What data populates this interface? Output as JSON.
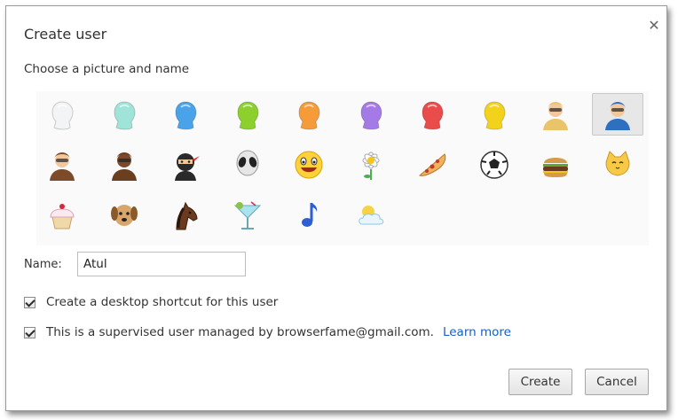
{
  "dialog": {
    "title": "Create user",
    "subtitle": "Choose a picture and name",
    "close_icon": "close-icon",
    "name_label": "Name:",
    "name_value": "Atul",
    "shortcut_label": "Create a desktop shortcut for this user",
    "shortcut_checked": true,
    "supervised_label": "This is a supervised user managed by browserfame@gmail.com.",
    "supervised_checked": true,
    "learn_more": "Learn more",
    "create_label": "Create",
    "cancel_label": "Cancel"
  },
  "avatars": [
    {
      "name": "avatar-head-white",
      "kind": "head",
      "color": "#f2f4f5",
      "selected": false
    },
    {
      "name": "avatar-head-teal",
      "kind": "head",
      "color": "#9fe3d9",
      "selected": false
    },
    {
      "name": "avatar-head-blue",
      "kind": "head",
      "color": "#4aa3e8",
      "selected": false
    },
    {
      "name": "avatar-head-green",
      "kind": "head",
      "color": "#8dcf2d",
      "selected": false
    },
    {
      "name": "avatar-head-orange",
      "kind": "head",
      "color": "#f59b3a",
      "selected": false
    },
    {
      "name": "avatar-head-purple",
      "kind": "head",
      "color": "#a47ae6",
      "selected": false
    },
    {
      "name": "avatar-head-red",
      "kind": "head",
      "color": "#ea4b4b",
      "selected": false
    },
    {
      "name": "avatar-head-yellow",
      "kind": "head",
      "color": "#f3d21c",
      "selected": false
    },
    {
      "name": "avatar-businesswoman",
      "kind": "person",
      "color": "#e9c46a",
      "selected": false
    },
    {
      "name": "avatar-superhero",
      "kind": "person",
      "color": "#2e6fc0",
      "selected": true
    },
    {
      "name": "avatar-woman-sunglasses",
      "kind": "person",
      "color": "#7b4b2a",
      "selected": false
    },
    {
      "name": "avatar-man",
      "kind": "person",
      "color": "#6b3e1f",
      "selected": false
    },
    {
      "name": "avatar-ninja",
      "kind": "ninja",
      "color": "#2a2a2a",
      "selected": false
    },
    {
      "name": "avatar-alien",
      "kind": "alien",
      "color": "#e6e6e6",
      "selected": false
    },
    {
      "name": "avatar-smiley",
      "kind": "smiley",
      "color": "#ffd23a",
      "selected": false
    },
    {
      "name": "avatar-flower",
      "kind": "flower",
      "color": "#ffffff",
      "selected": false
    },
    {
      "name": "avatar-pizza",
      "kind": "pizza",
      "color": "#f2b25a",
      "selected": false
    },
    {
      "name": "avatar-soccer-ball",
      "kind": "ball",
      "color": "#ffffff",
      "selected": false
    },
    {
      "name": "avatar-burger",
      "kind": "burger",
      "color": "#c98a3d",
      "selected": false
    },
    {
      "name": "avatar-cat",
      "kind": "cat",
      "color": "#f8c946",
      "selected": false
    },
    {
      "name": "avatar-cupcake",
      "kind": "cupcake",
      "color": "#f0d9a8",
      "selected": false
    },
    {
      "name": "avatar-dog",
      "kind": "dog",
      "color": "#d8a56a",
      "selected": false
    },
    {
      "name": "avatar-horse",
      "kind": "horse",
      "color": "#6b3a1f",
      "selected": false
    },
    {
      "name": "avatar-cocktail",
      "kind": "cocktail",
      "color": "#a9e3ef",
      "selected": false
    },
    {
      "name": "avatar-music-note",
      "kind": "note",
      "color": "#2d5fd0",
      "selected": false
    },
    {
      "name": "avatar-sun-cloud",
      "kind": "weather",
      "color": "#bfe4f7",
      "selected": false
    }
  ]
}
